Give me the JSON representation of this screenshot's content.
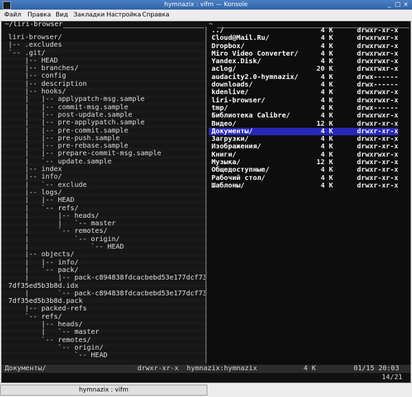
{
  "window": {
    "title": "hymnazix : vifm — Konsole",
    "controls": [
      "_",
      "□",
      "×"
    ]
  },
  "menu": [
    "Файл",
    "Правка",
    "Вид",
    "Закладки",
    "Настройка",
    "Справка"
  ],
  "left_pane": {
    "path": "~/liri-browser",
    "tree": [
      "liri-browser/",
      "|-- .excludes",
      "`-- .git/",
      "    |-- HEAD",
      "    |-- branches/",
      "    |-- config",
      "    |-- description",
      "    |-- hooks/",
      "    |   |-- applypatch-msg.sample",
      "    |   |-- commit-msg.sample",
      "    |   |-- post-update.sample",
      "    |   |-- pre-applypatch.sample",
      "    |   |-- pre-commit.sample",
      "    |   |-- pre-push.sample",
      "    |   |-- pre-rebase.sample",
      "    |   |-- prepare-commit-msg.sample",
      "    |   `-- update.sample",
      "    |-- index",
      "    |-- info/",
      "    |   `-- exclude",
      "    |-- logs/",
      "    |   |-- HEAD",
      "    |   `-- refs/",
      "    |       |-- heads/",
      "    |       |   `-- master",
      "    |       `-- remotes/",
      "    |           `-- origin/",
      "    |               `-- HEAD",
      "    |-- objects/",
      "    |   |-- info/",
      "    |   `-- pack/",
      "    |       |-- pack-c894838fdcacbebd53e177dcf73",
      "7df35ed5b3b8d.idx",
      "    |       `-- pack-c894838fdcacbebd53e177dcf73",
      "7df35ed5b3b8d.pack",
      "    |-- packed-refs",
      "    `-- refs/",
      "        |-- heads/",
      "        |   `-- master",
      "        `-- remotes/",
      "            `-- origin/",
      "                `-- HEAD"
    ]
  },
  "right_pane": {
    "path": "~",
    "files": [
      {
        "name": "../",
        "size": "4 K",
        "perms": "drwxr-xr-x"
      },
      {
        "name": "Cloud@Mail.Ru/",
        "size": "4 K",
        "perms": "drwxrwxr-x"
      },
      {
        "name": "Dropbox/",
        "size": "4 K",
        "perms": "drwxrwxr-x"
      },
      {
        "name": "Miro Video Converter/",
        "size": "4 K",
        "perms": "drwxrwxr-x"
      },
      {
        "name": "Yandex.Disk/",
        "size": "4 K",
        "perms": "drwxrwxr-x"
      },
      {
        "name": "aclog/",
        "size": "20 K",
        "perms": "drwxrwxr-x"
      },
      {
        "name": "audacity2.0-hymnazix/",
        "size": "4 K",
        "perms": "drwx------"
      },
      {
        "name": "downloads/",
        "size": "4 K",
        "perms": "drwx------"
      },
      {
        "name": "kdenlive/",
        "size": "4 K",
        "perms": "drwxrwxr-x"
      },
      {
        "name": "liri-browser/",
        "size": "4 K",
        "perms": "drwxrwxr-x"
      },
      {
        "name": "tmp/",
        "size": "4 K",
        "perms": "drwx------"
      },
      {
        "name": "Библиотека Calibre/",
        "size": "4 K",
        "perms": "drwxrwxr-x"
      },
      {
        "name": "Видео/",
        "size": "12 K",
        "perms": "drwxr-xr-x"
      },
      {
        "name": "Документы/",
        "size": "4 K",
        "perms": "drwxr-xr-x",
        "selected": true
      },
      {
        "name": "Загрузки/",
        "size": "4 K",
        "perms": "drwxr-xr-x"
      },
      {
        "name": "Изображения/",
        "size": "4 K",
        "perms": "drwxr-xr-x"
      },
      {
        "name": "Книги/",
        "size": "4 K",
        "perms": "drwxrwxr-x"
      },
      {
        "name": "Музыка/",
        "size": "12 K",
        "perms": "drwxr-xr-x"
      },
      {
        "name": "Общедоступные/",
        "size": "4 K",
        "perms": "drwxr-xr-x"
      },
      {
        "name": "Рабочий стол/",
        "size": "4 K",
        "perms": "drwxr-xr-x"
      },
      {
        "name": "Шаблоны/",
        "size": "4 K",
        "perms": "drwxr-xr-x"
      }
    ]
  },
  "status": {
    "name": "Документы/",
    "perms": "drwxr-xr-x",
    "owner": "hymnazix:hymnazix",
    "size": "4 K",
    "date": "01/15 20:03",
    "position": "14/21"
  },
  "taskbar": {
    "task": "hymnazix : vifm"
  },
  "colors": {
    "selection": "#2828b8",
    "terminal_bg": "#121212"
  }
}
